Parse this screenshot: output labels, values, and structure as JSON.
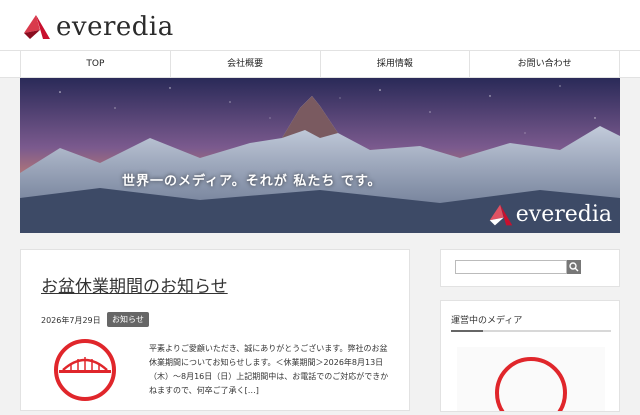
{
  "brand": {
    "name": "everedia",
    "accent": "#c8102e"
  },
  "nav": {
    "items": [
      "TOP",
      "会社概要",
      "採用情報",
      "お問い合わせ"
    ]
  },
  "hero": {
    "tagline": "世界一のメディア。それが 私たち です。",
    "logo_text": "everedia"
  },
  "post": {
    "title": "お盆休業期間のお知らせ",
    "date": "2026年7月29日",
    "category": "お知らせ",
    "excerpt": "平素よりご愛顧いただき、誠にありがとうございます。弊社のお盆休業期間についてお知らせします。＜休業期間＞2026年8月13日（木）～8月16日（日）上記期間中は、お電話でのご対応ができかねますので、何卒ご了承く[…]"
  },
  "sidebar": {
    "search": {
      "placeholder": "",
      "icon": "search-icon"
    },
    "media_title": "運営中のメディア"
  }
}
